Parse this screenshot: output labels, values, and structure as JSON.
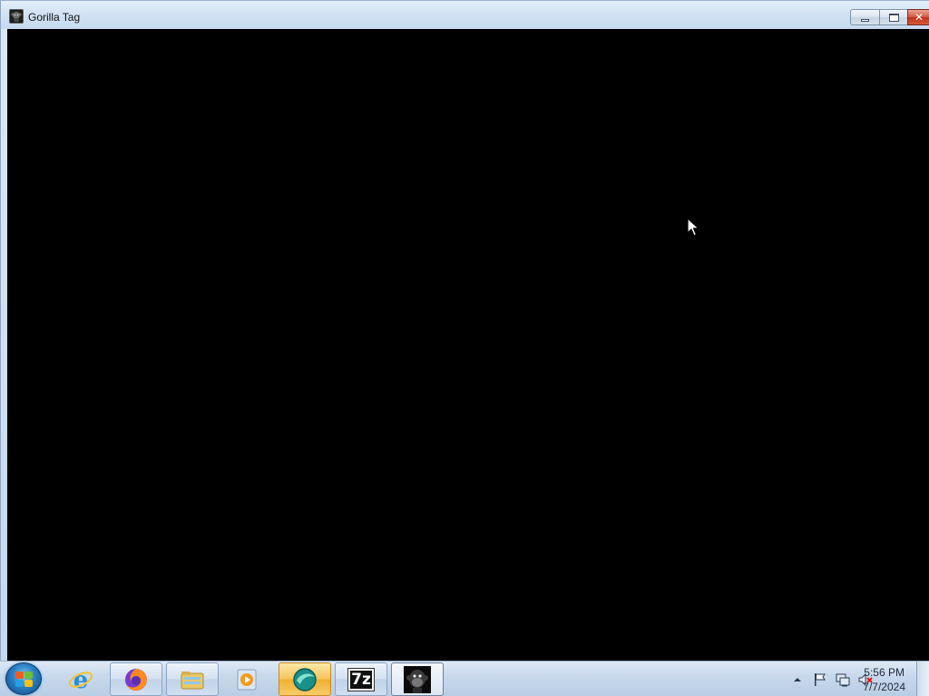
{
  "window": {
    "title": "Gorilla Tag",
    "icon": "gorilla-app-icon",
    "buttons": {
      "minimize": "minimize-icon",
      "restore": "restore-icon",
      "close": "✕"
    },
    "client_background": "#000000"
  },
  "taskbar": {
    "start_button": "windows-start-icon",
    "items": [
      {
        "name": "internet-explorer-icon",
        "state": "pinned"
      },
      {
        "name": "firefox-icon",
        "state": "running"
      },
      {
        "name": "file-explorer-icon",
        "state": "running"
      },
      {
        "name": "media-player-icon",
        "state": "pinned"
      },
      {
        "name": "app-teal-icon",
        "state": "active"
      },
      {
        "name": "7zip-icon",
        "label": "7z",
        "state": "running"
      },
      {
        "name": "gorilla-tag-icon",
        "state": "running"
      }
    ],
    "tray": [
      "show-hidden-icons-arrow",
      "action-center-flag-icon",
      "network-icon",
      "volume-muted-icon"
    ],
    "clock": {
      "time": "5:56 PM",
      "date": "7/7/2024"
    }
  },
  "colors": {
    "accent_orange": "#f0ae2e",
    "close_red": "#c1321c",
    "taskbar": "#c8d9ec"
  }
}
